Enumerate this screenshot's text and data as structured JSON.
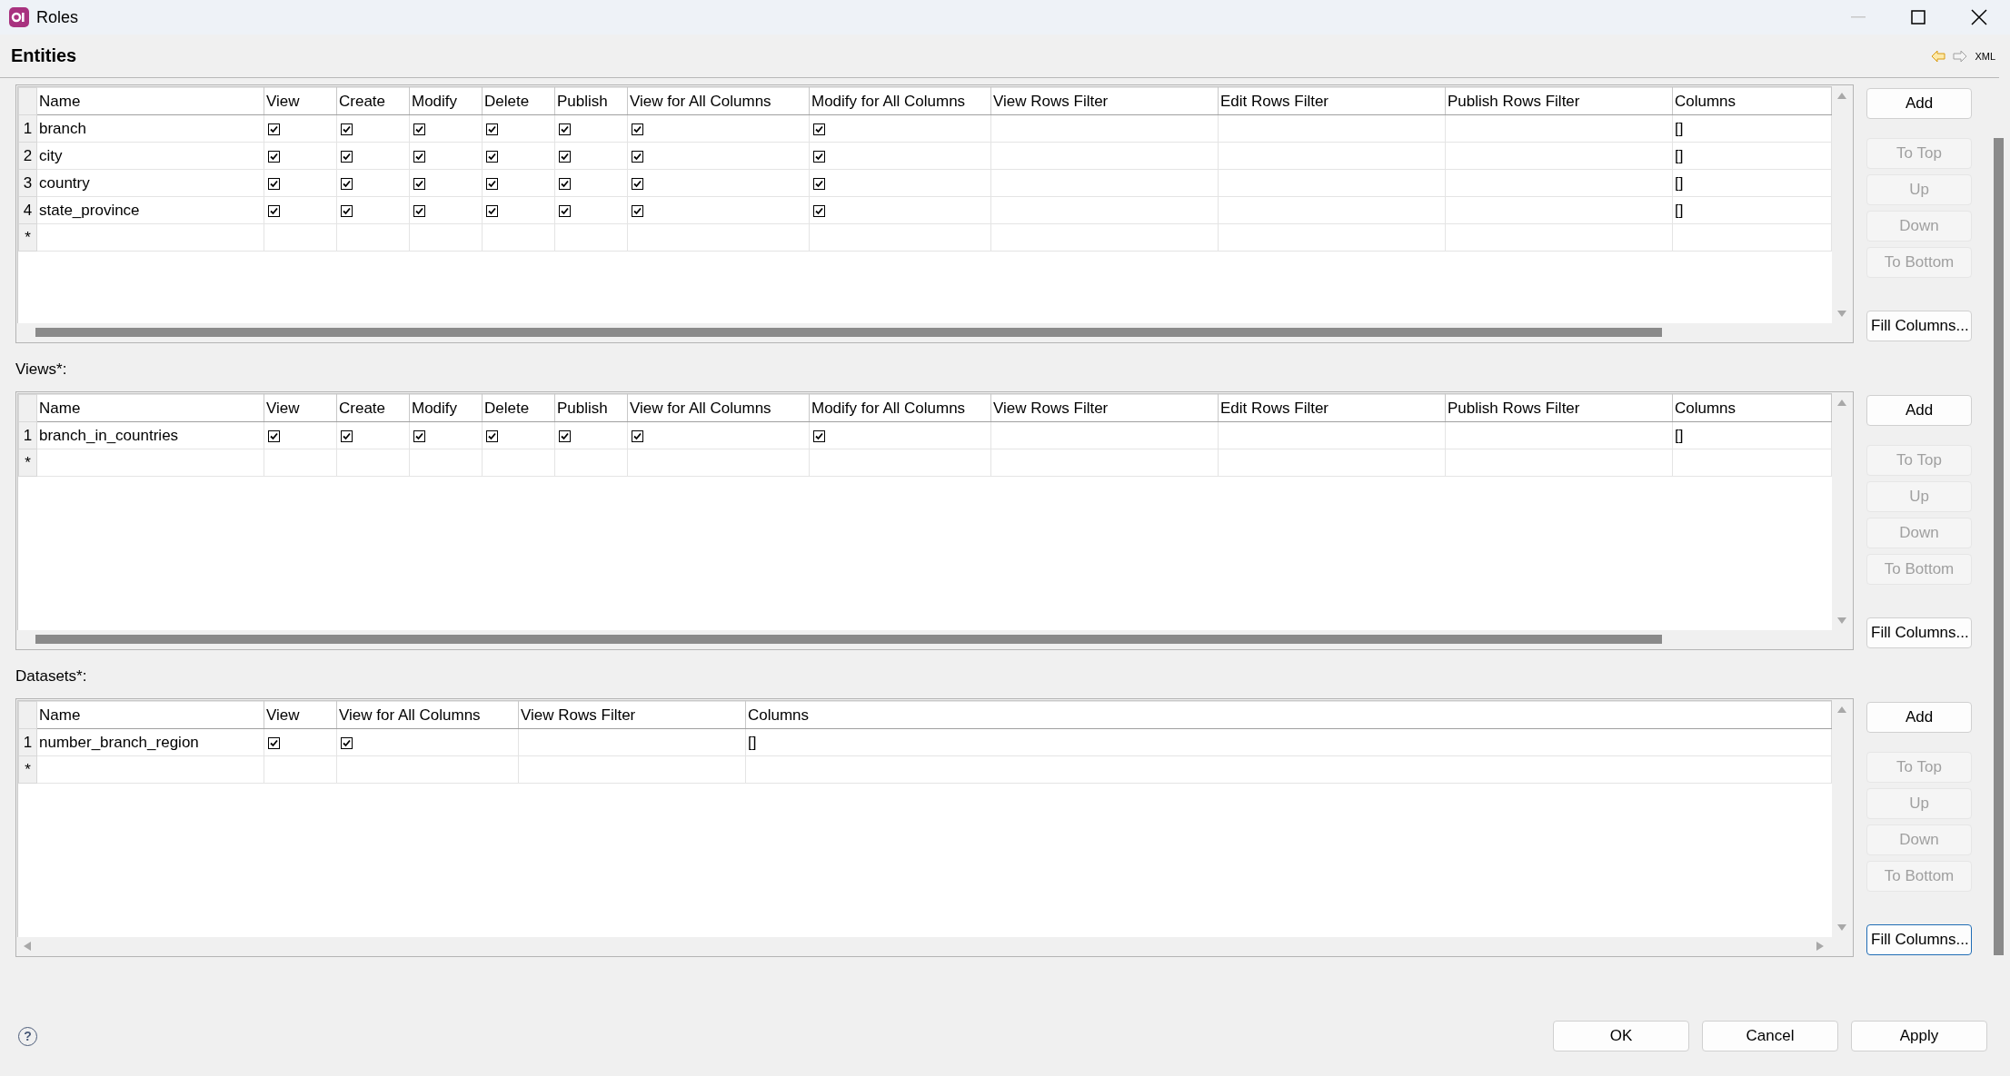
{
  "window": {
    "title": "Roles"
  },
  "header": {
    "title": "Entities",
    "xml_label": "XML"
  },
  "tables": [
    {
      "hscroll_thumb": true,
      "new_row_marker": "*",
      "columns": [
        {
          "label": "Name",
          "kind": "name"
        },
        {
          "label": "View",
          "kind": "flag"
        },
        {
          "label": "Create",
          "kind": "flag"
        },
        {
          "label": "Modify",
          "kind": "flag"
        },
        {
          "label": "Delete",
          "kind": "flag"
        },
        {
          "label": "Publish",
          "kind": "flag"
        },
        {
          "label": "View for All Columns",
          "kind": "wide_flag"
        },
        {
          "label": "Modify for All Columns",
          "kind": "wide_flag"
        },
        {
          "label": "View Rows Filter",
          "kind": "filter"
        },
        {
          "label": "Edit Rows Filter",
          "kind": "filter"
        },
        {
          "label": "Publish Rows Filter",
          "kind": "filter"
        },
        {
          "label": "Columns",
          "kind": "columns"
        }
      ],
      "rows": [
        {
          "number": "1",
          "name": "branch",
          "flags": [
            true,
            true,
            true,
            true,
            true,
            true,
            true
          ],
          "columns": "[]"
        },
        {
          "number": "2",
          "name": "city",
          "flags": [
            true,
            true,
            true,
            true,
            true,
            true,
            true
          ],
          "columns": "[]"
        },
        {
          "number": "3",
          "name": "country",
          "flags": [
            true,
            true,
            true,
            true,
            true,
            true,
            true
          ],
          "columns": "[]"
        },
        {
          "number": "4",
          "name": "state_province",
          "flags": [
            true,
            true,
            true,
            true,
            true,
            true,
            true
          ],
          "columns": "[]"
        }
      ],
      "buttons": [
        {
          "label": "Add",
          "disabled": false,
          "focused": false
        },
        {
          "label": "To Top",
          "disabled": true,
          "focused": false
        },
        {
          "label": "Up",
          "disabled": true,
          "focused": false
        },
        {
          "label": "Down",
          "disabled": true,
          "focused": false
        },
        {
          "label": "To Bottom",
          "disabled": true,
          "focused": false
        },
        {
          "label": "Fill Columns...",
          "disabled": false,
          "focused": false
        }
      ]
    },
    {
      "label": "Views*:",
      "hscroll_thumb": true,
      "new_row_marker": "*",
      "columns": [
        {
          "label": "Name",
          "kind": "name"
        },
        {
          "label": "View",
          "kind": "flag"
        },
        {
          "label": "Create",
          "kind": "flag"
        },
        {
          "label": "Modify",
          "kind": "flag"
        },
        {
          "label": "Delete",
          "kind": "flag"
        },
        {
          "label": "Publish",
          "kind": "flag"
        },
        {
          "label": "View for All Columns",
          "kind": "wide_flag"
        },
        {
          "label": "Modify for All Columns",
          "kind": "wide_flag"
        },
        {
          "label": "View Rows Filter",
          "kind": "filter"
        },
        {
          "label": "Edit Rows Filter",
          "kind": "filter"
        },
        {
          "label": "Publish Rows Filter",
          "kind": "filter"
        },
        {
          "label": "Columns",
          "kind": "columns"
        }
      ],
      "rows": [
        {
          "number": "1",
          "name": "branch_in_countries",
          "flags": [
            true,
            true,
            true,
            true,
            true,
            true,
            true
          ],
          "columns": "[]"
        }
      ],
      "buttons": [
        {
          "label": "Add",
          "disabled": false,
          "focused": false
        },
        {
          "label": "To Top",
          "disabled": true,
          "focused": false
        },
        {
          "label": "Up",
          "disabled": true,
          "focused": false
        },
        {
          "label": "Down",
          "disabled": true,
          "focused": false
        },
        {
          "label": "To Bottom",
          "disabled": true,
          "focused": false
        },
        {
          "label": "Fill Columns...",
          "disabled": false,
          "focused": false
        }
      ]
    },
    {
      "label": "Datasets*:",
      "hscroll_thumb": false,
      "new_row_marker": "*",
      "columns": [
        {
          "label": "Name",
          "kind": "name"
        },
        {
          "label": "View",
          "kind": "flag"
        },
        {
          "label": "View for All Columns",
          "kind": "wide_flag"
        },
        {
          "label": "View Rows Filter",
          "kind": "filter"
        },
        {
          "label": "Columns",
          "kind": "columns"
        }
      ],
      "rows": [
        {
          "number": "1",
          "name": "number_branch_region",
          "flags": [
            true,
            true
          ],
          "columns": "[]"
        }
      ],
      "buttons": [
        {
          "label": "Add",
          "disabled": false,
          "focused": false
        },
        {
          "label": "To Top",
          "disabled": true,
          "focused": false
        },
        {
          "label": "Up",
          "disabled": true,
          "focused": false
        },
        {
          "label": "Down",
          "disabled": true,
          "focused": false
        },
        {
          "label": "To Bottom",
          "disabled": true,
          "focused": false
        },
        {
          "label": "Fill Columns...",
          "disabled": false,
          "focused": true
        }
      ]
    }
  ],
  "help_symbol": "?",
  "footer_buttons": [
    {
      "label": "OK"
    },
    {
      "label": "Cancel"
    },
    {
      "label": "Apply"
    }
  ]
}
